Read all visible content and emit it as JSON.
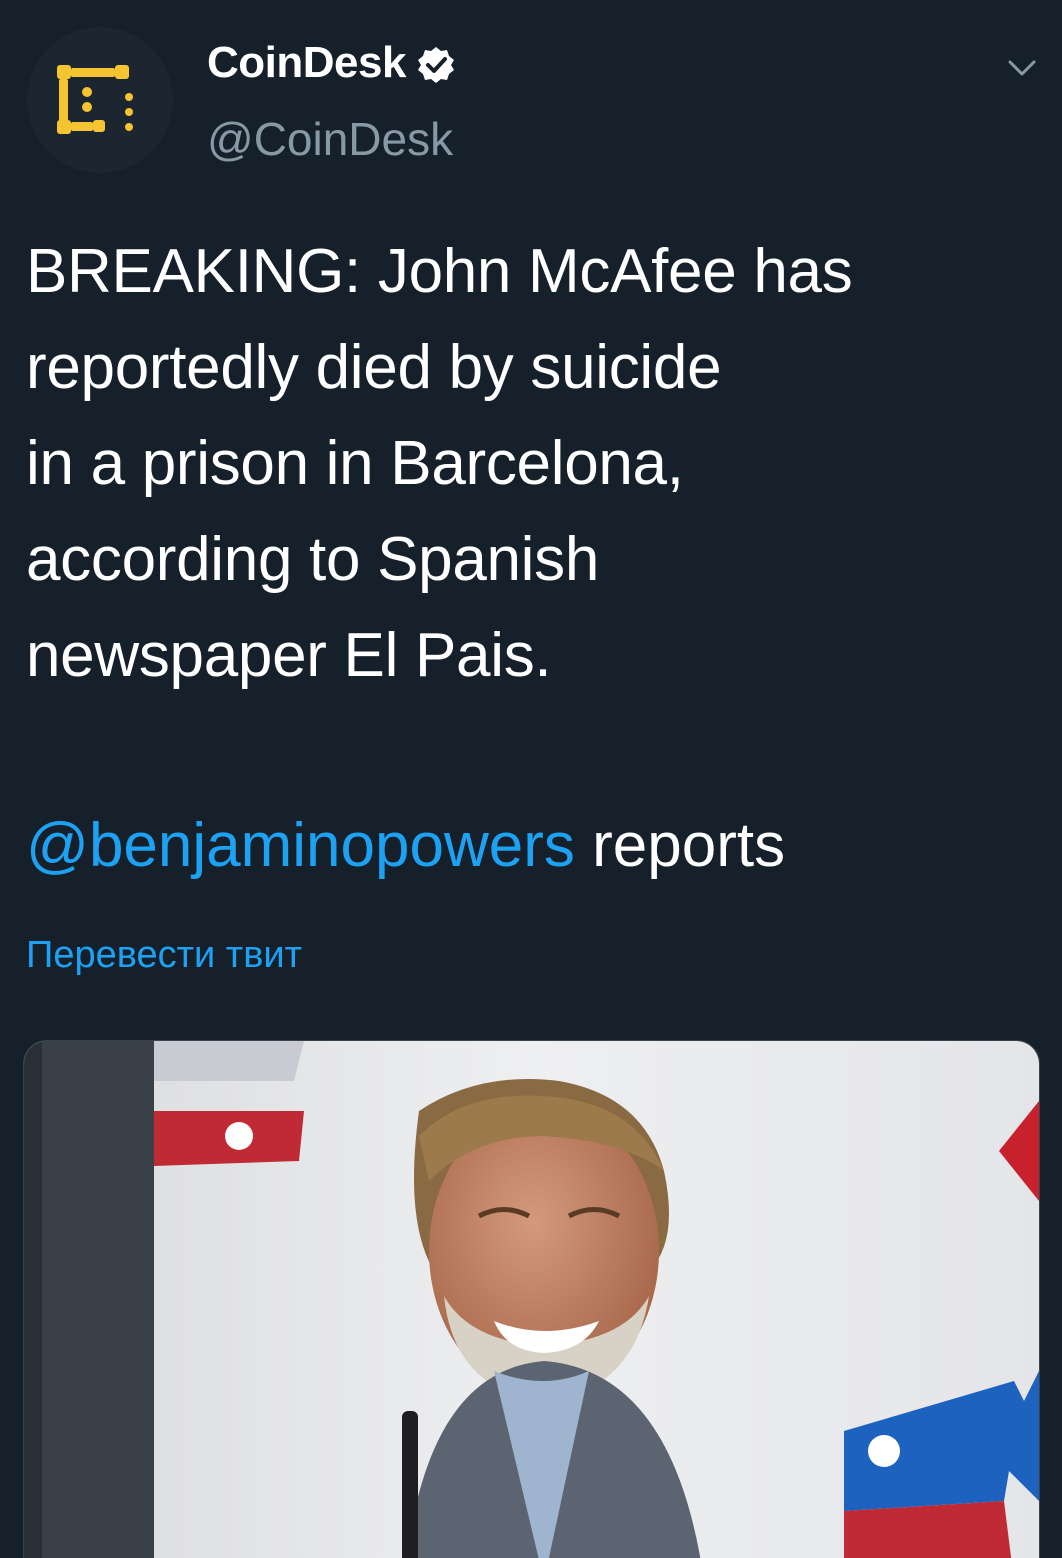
{
  "tweet": {
    "author": {
      "name": "CoinDesk",
      "handle": "@CoinDesk",
      "avatar_icon": "coindesk-logo-icon",
      "verified_icon": "verified-badge-icon"
    },
    "menu_icon": "chevron-down-icon",
    "text_lines": [
      "BREAKING: John McAfee has",
      "reportedly died by suicide",
      "in a prison in Barcelona,",
      "according to Spanish",
      "newspaper El Pais."
    ],
    "mention": "@benjaminopowers",
    "mention_suffix": " reports",
    "translate_label": "Перевести твит",
    "media_icon": "photo-man-smiling"
  },
  "colors": {
    "background": "#15202b",
    "text": "#ffffff",
    "secondary": "#8899a6",
    "link": "#1da1f2",
    "brand_yellow": "#f4c431"
  }
}
